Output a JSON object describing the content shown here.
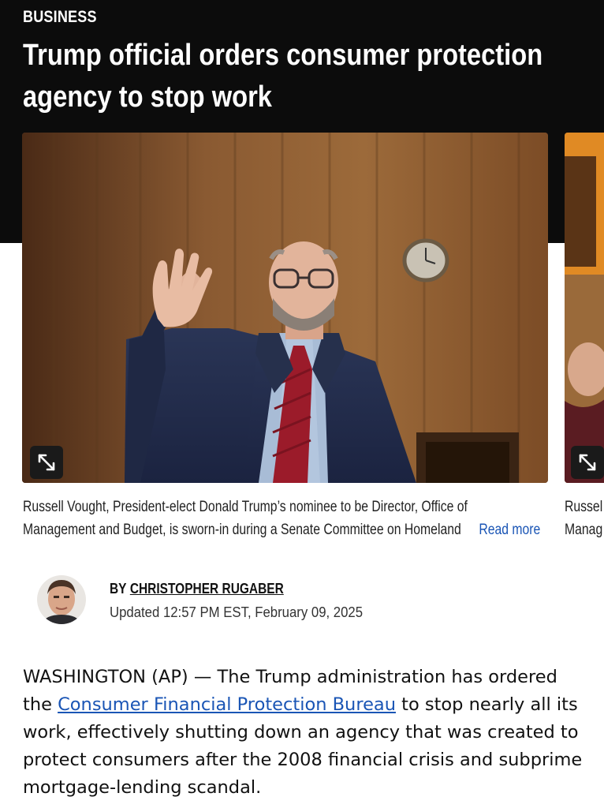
{
  "section": {
    "label": "BUSINESS"
  },
  "article": {
    "headline": "Trump official orders consumer protection agency to stop work",
    "image_expand_icon": "expand-arrows-icon",
    "caption": {
      "line1": "Russell Vought, President-elect Donald Trump’s nominee to be Director, Office of",
      "line2": "Management and Budget, is sworn-in during a Senate Committee on Homeland",
      "read_more": "Read more",
      "next_line1": "Russel",
      "next_line2": "Manag"
    },
    "byline": {
      "prefix": "BY",
      "author": "CHRISTOPHER RUGABER",
      "updated": "Updated 12:57 PM EST, February 09, 2025"
    },
    "body": {
      "lead_before": "WASHINGTON (AP) — The Trump administration has ordered the ",
      "link_text": "Consumer Financial Protection Bureau",
      "lead_after": " to stop nearly all its work, effectively shutting down an agency that was created to protect consumers after the 2008 financial crisis and subprime mortgage-lending scandal."
    }
  },
  "colors": {
    "header_bg": "#0c0c0c",
    "link": "#1a55b5",
    "text": "#111111"
  }
}
